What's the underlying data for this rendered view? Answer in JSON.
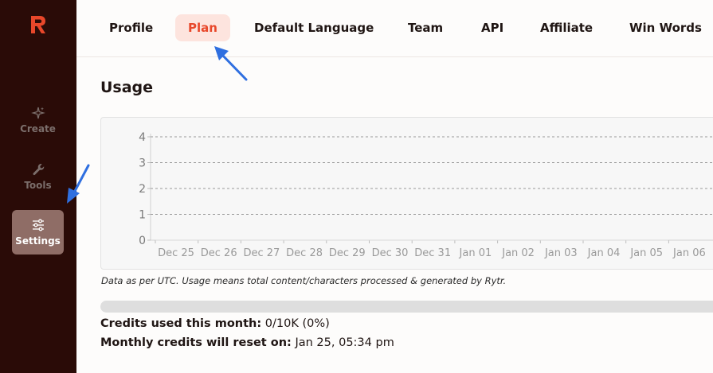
{
  "sidebar": {
    "items": [
      {
        "label": "Create",
        "icon": "sparkles-icon",
        "active": false
      },
      {
        "label": "Tools",
        "icon": "wrench-icon",
        "active": false
      },
      {
        "label": "Settings",
        "icon": "sliders-icon",
        "active": true
      }
    ]
  },
  "tabs": [
    {
      "label": "Profile",
      "active": false
    },
    {
      "label": "Plan",
      "active": true
    },
    {
      "label": "Default Language",
      "active": false
    },
    {
      "label": "Team",
      "active": false
    },
    {
      "label": "API",
      "active": false
    },
    {
      "label": "Affiliate",
      "active": false
    },
    {
      "label": "Win Words",
      "active": false
    }
  ],
  "usage": {
    "title": "Usage",
    "note": "Data as per UTC. Usage means total content/characters processed & generated by Rytr.",
    "progress_percent": 0,
    "credits_used_label": "Credits used this month:",
    "credits_used_value": "0/10K (0%)",
    "reset_label": "Monthly credits will reset on:",
    "reset_value": "Jan 25, 05:34 pm"
  },
  "chart_data": {
    "type": "line",
    "x": [
      "Dec 25",
      "Dec 26",
      "Dec 27",
      "Dec 28",
      "Dec 29",
      "Dec 30",
      "Dec 31",
      "Jan 01",
      "Jan 02",
      "Jan 03",
      "Jan 04",
      "Jan 05",
      "Jan 06"
    ],
    "series": [
      {
        "values": [
          0,
          0,
          0,
          0,
          0,
          0,
          0,
          0,
          0,
          0,
          0,
          0,
          0
        ]
      }
    ],
    "yticks": [
      0,
      1,
      2,
      3,
      4
    ],
    "ylim": [
      0,
      4
    ],
    "grid": true
  },
  "colors": {
    "accent": "#e8472a",
    "sidebar_bg": "#2a0b07",
    "active_tab_bg": "#fde4de",
    "annotation_arrow": "#2f6fe0"
  }
}
